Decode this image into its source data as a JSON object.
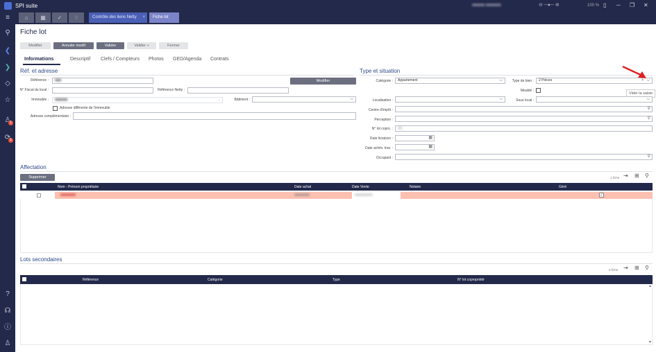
{
  "app": {
    "title": "SPI suite",
    "zoom": "100 %",
    "user_blurred": "■■■■■ ■■■■■■"
  },
  "tabs": [
    {
      "label": "Contrôle des liens Netty",
      "close": "×"
    },
    {
      "label": "Fiche lot"
    }
  ],
  "page": {
    "title": "Fiche lot"
  },
  "toolbar": {
    "modifier": "Modifier",
    "annuler": "Annuler modif",
    "valider": "Valider",
    "valider_plus": "Valider +",
    "fermer": "Fermer"
  },
  "subtabs": [
    "Informations",
    "Descriptif",
    "Clefs / Compteurs",
    "Photos",
    "GED/Agenda",
    "Contrats"
  ],
  "ref": {
    "section": "Réf. et adresse",
    "reference_label": "Référence :",
    "reference_value": "■■■",
    "modifier_button": "Modifier",
    "fiscal_label": "N° Fiscal du local :",
    "netty_label": "Référence Netty :",
    "immeuble_label": "Immeuble :",
    "immeuble_value": "■■■■■■",
    "batiment_label": "Bâtiment :",
    "adresse_diff_label": "Adresse différente de l'immeuble",
    "adresse_comp_label": "Adresse complémentaire :"
  },
  "type": {
    "section": "Type et situation",
    "categorie_label": "Catégorie :",
    "categorie_value": "Appartement",
    "type_bien_label": "Type de bien :",
    "type_bien_value": "2 Pièces",
    "meuble_label": "Meublé :",
    "localisation_label": "Localisation :",
    "sous_local_label": "Sous local :",
    "centre_label": "Centre d'impôt :",
    "perception_label": "Perception :",
    "lot_copro_label": "N° lot copro. :",
    "lot_copro_value": "■■",
    "date_livraison_label": "Date livraison :",
    "date_achev_label": "Date achèv. trav. :",
    "occupant_label": "Occupant :",
    "tooltip": "Vider la saisie"
  },
  "affectation": {
    "section": "Affectation",
    "supprimer": "Supprimer",
    "count": "1 fiche",
    "columns": [
      "Nom - Prénom propriétaire",
      "Date achat",
      "Date Vente",
      "Notaire",
      "Géré"
    ],
    "row": {
      "nom": "■■■■■■",
      "date_achat": "■■■■■■",
      "date_vente": "■■■■■■■",
      "gere": "✓"
    }
  },
  "lots": {
    "section": "Lots secondaires",
    "count": "0 fiche",
    "columns": [
      "Référence",
      "Catégorie",
      "Type",
      "N° lot copropriété"
    ]
  },
  "colors": {
    "navy": "#23294a",
    "accent": "#2d4a8a",
    "row_highlight": "#fcc0b0",
    "arrow": "#e02020"
  }
}
